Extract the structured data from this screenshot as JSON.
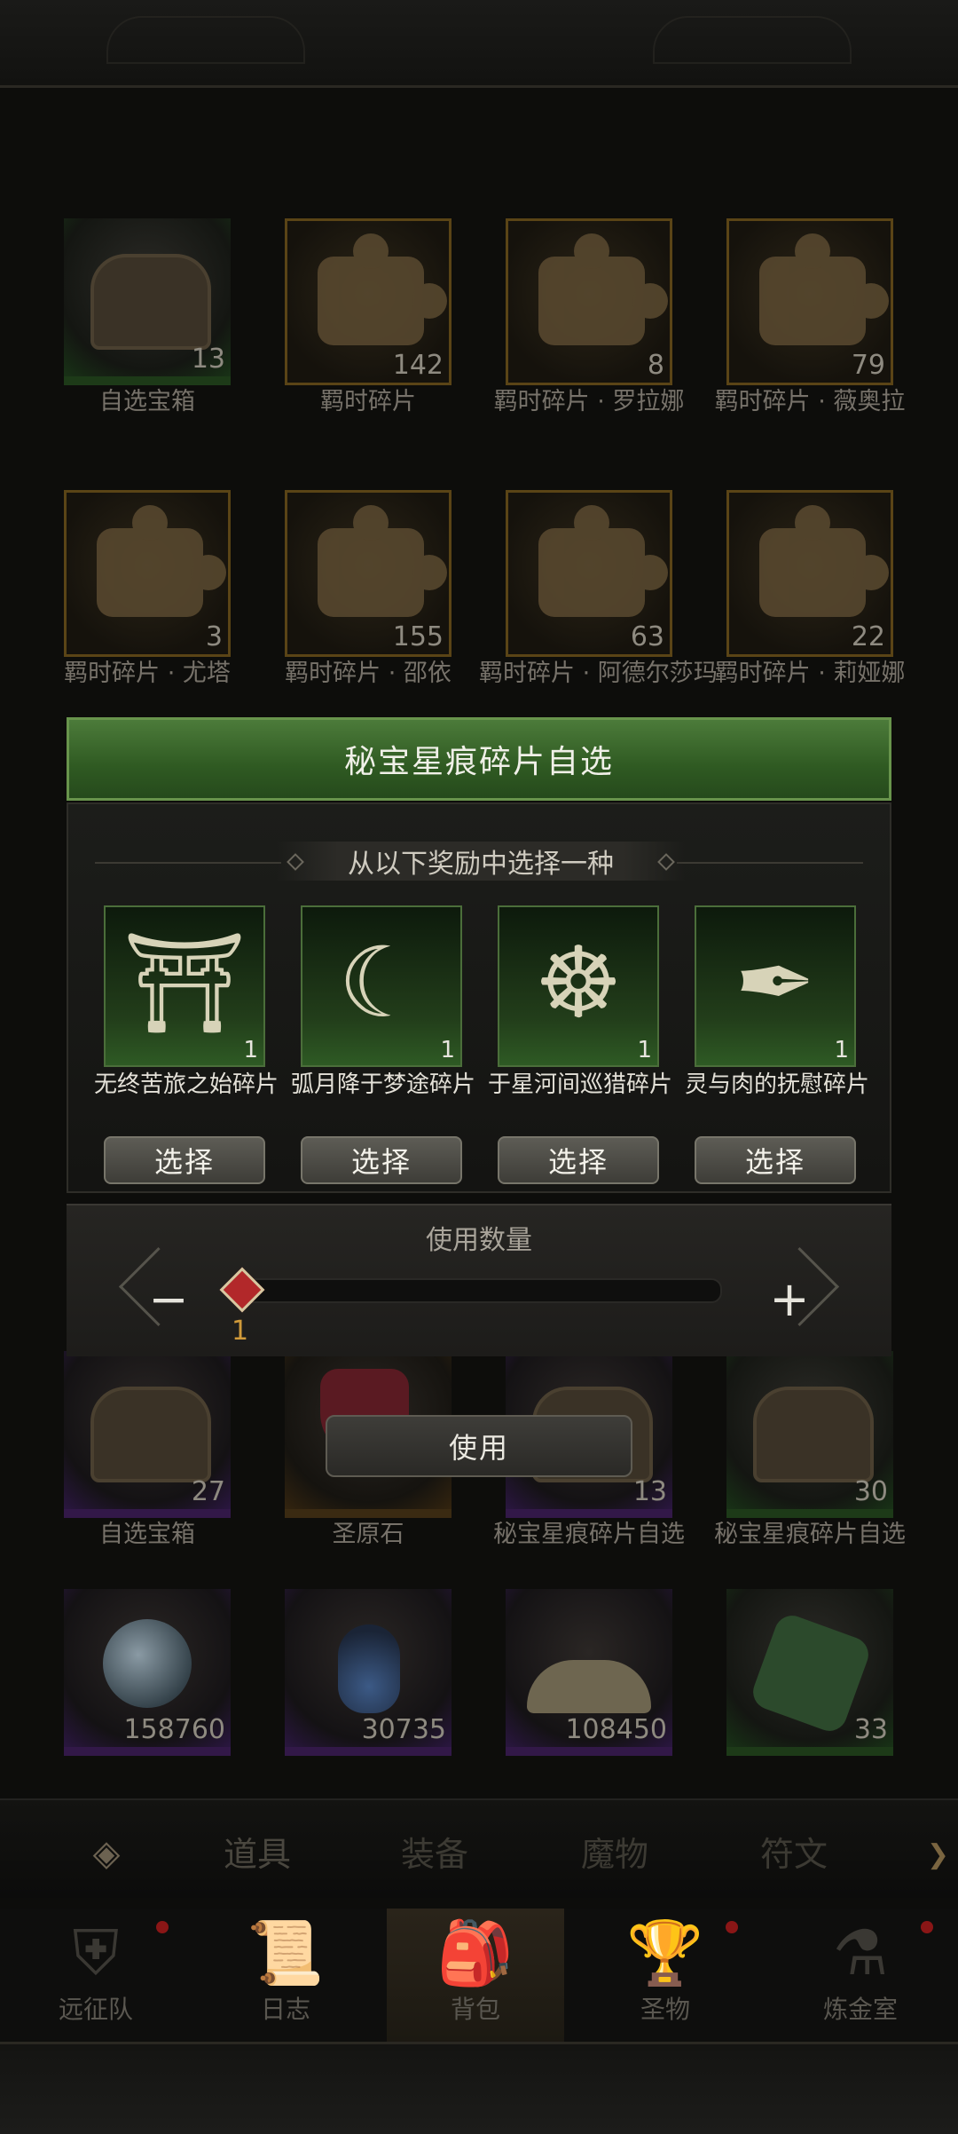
{
  "grid_items": [
    {
      "name": "自选宝箱",
      "count": "13",
      "style": "green",
      "icon": "chest-icon"
    },
    {
      "name": "羁时碎片",
      "count": "142",
      "style": "gold",
      "icon": "puzzle-icon"
    },
    {
      "name": "羁时碎片 · 罗拉娜",
      "count": "8",
      "style": "gold",
      "icon": "puzzle-icon"
    },
    {
      "name": "羁时碎片 · 薇奥拉",
      "count": "79",
      "style": "gold",
      "icon": "puzzle-icon"
    },
    {
      "name": "羁时碎片 · 尤塔",
      "count": "3",
      "style": "gold",
      "icon": "puzzle-icon"
    },
    {
      "name": "羁时碎片 · 邵依",
      "count": "155",
      "style": "gold",
      "icon": "puzzle-icon"
    },
    {
      "name": "羁时碎片 · 阿德尔莎玛",
      "count": "63",
      "style": "gold",
      "icon": "puzzle-icon"
    },
    {
      "name": "羁时碎片 · 莉娅娜",
      "count": "22",
      "style": "gold",
      "icon": "puzzle-icon"
    },
    {
      "name": "自选宝箱",
      "count": "27",
      "style": "purple",
      "icon": "chest-icon"
    },
    {
      "name": "圣原石",
      "count": "",
      "style": "brown",
      "icon": "gem-icon"
    },
    {
      "name": "秘宝星痕碎片自选",
      "count": "13",
      "style": "purple",
      "icon": "chest-icon"
    },
    {
      "name": "秘宝星痕碎片自选",
      "count": "30",
      "style": "green",
      "icon": "chest-icon"
    },
    {
      "name": "",
      "count": "158760",
      "style": "purple",
      "icon": "orb-icon"
    },
    {
      "name": "",
      "count": "30735",
      "style": "purple",
      "icon": "potion-icon"
    },
    {
      "name": "",
      "count": "108450",
      "style": "purple",
      "icon": "dust-icon"
    },
    {
      "name": "",
      "count": "33",
      "style": "green",
      "icon": "stone-icon"
    }
  ],
  "modal": {
    "title": "秘宝星痕碎片自选",
    "subtitle": "从以下奖励中选择一种",
    "rewards": [
      {
        "name": "无终苦旅之始碎片",
        "count": "1",
        "button": "选择",
        "icon": "door-icon",
        "glyph": "⛩"
      },
      {
        "name": "弧月降于梦途碎片",
        "count": "1",
        "button": "选择",
        "icon": "crescent-moon-icon",
        "glyph": "☾"
      },
      {
        "name": "于星河间巡猎碎片",
        "count": "1",
        "button": "选择",
        "icon": "chariot-icon",
        "glyph": "☸"
      },
      {
        "name": "灵与肉的抚慰碎片",
        "count": "1",
        "button": "选择",
        "icon": "feather-icon",
        "glyph": "✒"
      }
    ],
    "quantity_label": "使用数量",
    "quantity_value": "1",
    "minus": "−",
    "plus": "+",
    "use_button": "使用"
  },
  "tabs": {
    "back_icon": "◈",
    "items": [
      "道具",
      "装备",
      "魔物",
      "符文"
    ],
    "active": 0,
    "more": "❯"
  },
  "bottom_nav": [
    {
      "label": "远征队",
      "icon": "helmet-icon",
      "glyph": "⛨",
      "dot": true
    },
    {
      "label": "日志",
      "icon": "scroll-icon",
      "glyph": "📜",
      "dot": false
    },
    {
      "label": "背包",
      "icon": "backpack-icon",
      "glyph": "🎒",
      "dot": false
    },
    {
      "label": "圣物",
      "icon": "chalice-icon",
      "glyph": "🏆",
      "dot": true
    },
    {
      "label": "炼金室",
      "icon": "alchemy-icon",
      "glyph": "⚗",
      "dot": true
    }
  ],
  "colors": {
    "accent_green": "#4c7b3a",
    "slider_red": "#b2282a",
    "value_gold": "#d09a3a"
  }
}
